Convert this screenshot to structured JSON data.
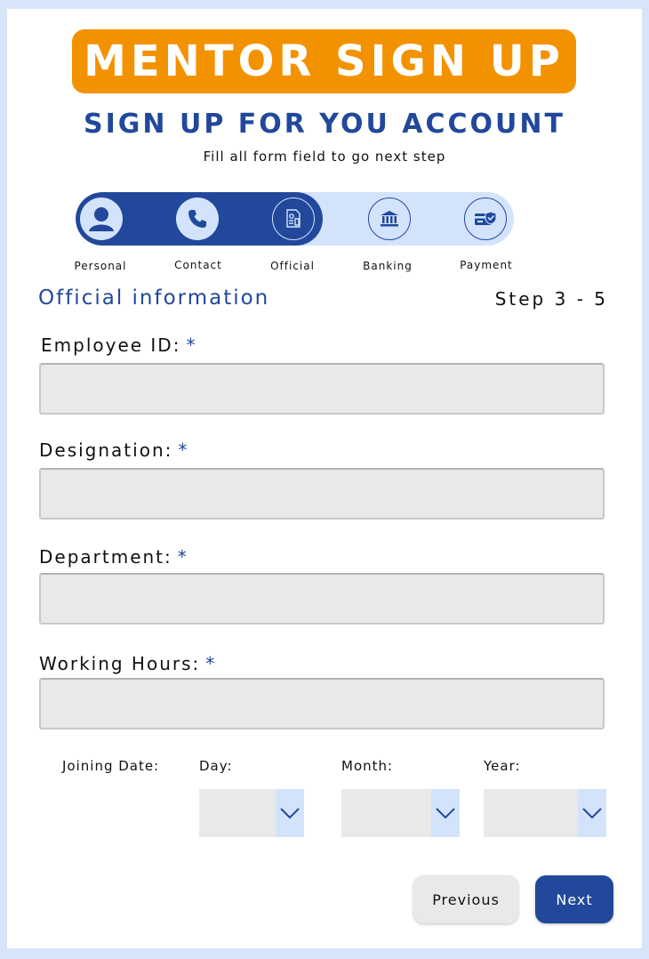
{
  "header": {
    "banner": "MENTOR SIGN UP",
    "subtitle": "SIGN UP FOR YOU ACCOUNT",
    "hint": "Fill all form field to go next step"
  },
  "steps": [
    {
      "label": "Personal",
      "icon": "user-icon",
      "state": "done"
    },
    {
      "label": "Contact",
      "icon": "phone-icon",
      "state": "done"
    },
    {
      "label": "Official",
      "icon": "document-icon",
      "state": "active"
    },
    {
      "label": "Banking",
      "icon": "bank-icon",
      "state": "todo"
    },
    {
      "label": "Payment",
      "icon": "card-check-icon",
      "state": "todo"
    }
  ],
  "section": {
    "title": "Official information",
    "step": "Step 3 - 5"
  },
  "fields": {
    "employee_id": {
      "label": "Employee ID:",
      "required": "*",
      "value": ""
    },
    "designation": {
      "label": "Designation:",
      "required": "*",
      "value": ""
    },
    "department": {
      "label": "Department:",
      "required": "*",
      "value": ""
    },
    "working_hours": {
      "label": "Working Hours:",
      "required": "*",
      "value": ""
    }
  },
  "joining_date": {
    "label": "Joining Date:",
    "day": {
      "label": "Day:",
      "value": ""
    },
    "month": {
      "label": "Month:",
      "value": ""
    },
    "year": {
      "label": "Year:",
      "value": ""
    }
  },
  "buttons": {
    "previous": "Previous",
    "next": "Next"
  },
  "colors": {
    "brand_orange": "#f39200",
    "brand_blue": "#21489b",
    "light_blue": "#d3e3fc",
    "field_bg": "#e9e9e9"
  }
}
